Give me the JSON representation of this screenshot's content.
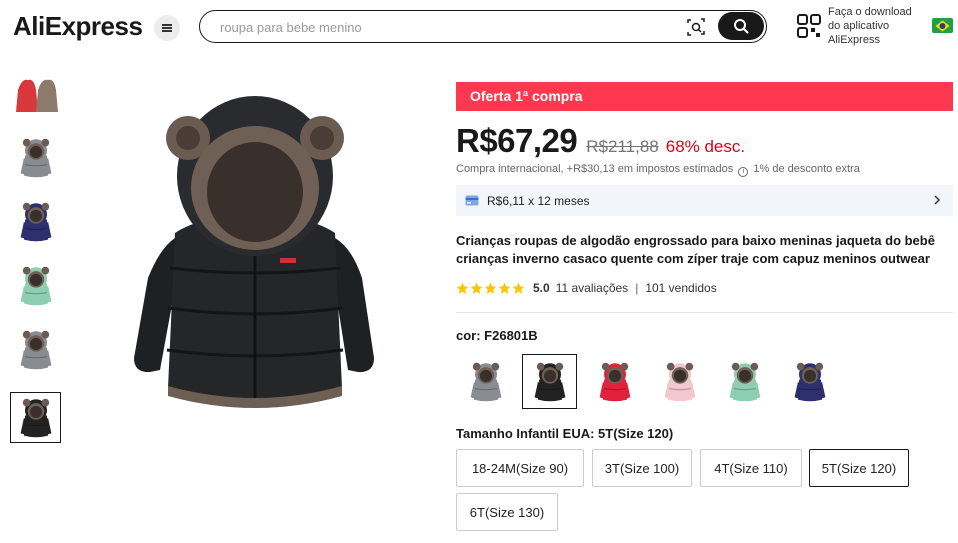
{
  "header": {
    "logo": "AliExpress",
    "search_placeholder": "roupa para bebe menino",
    "app_download_text": "Faça o download do aplicativo AliExpress",
    "icons": [
      "menu-icon",
      "camera-search-icon",
      "search-icon",
      "qr-code-icon",
      "brazil-flag-icon"
    ]
  },
  "thumbnails": [
    {
      "color": "#d8373c",
      "alt_color": "#8c7a6b"
    },
    {
      "color": "#8a8c93"
    },
    {
      "color": "#2d2f6e"
    },
    {
      "color": "#8fcfb1"
    },
    {
      "color": "#8a8c93"
    },
    {
      "color": "#222222",
      "active": true
    }
  ],
  "product": {
    "promo_label": "Oferta 1ª compra",
    "price": "R$67,29",
    "old_price": "R$211,88",
    "discount": "68% desc.",
    "tax_text": "Compra internacional, +R$30,13 em impostos estimados",
    "extra_discount": "1% de desconto extra",
    "installments": "R$6,11 x 12 meses",
    "title": "Crianças roupas de algodão engrossado para baixo meninas jaqueta do bebê crianças inverno casaco quente com zíper traje com capuz meninos outwear",
    "rating_value": "5.0",
    "reviews": "11 avaliações",
    "sold": "101 vendidos",
    "stars": 5,
    "color_label": "cor: F26801B",
    "colors": [
      {
        "name": "gray",
        "hex": "#8a8c93"
      },
      {
        "name": "black",
        "hex": "#222222",
        "selected": true
      },
      {
        "name": "red",
        "hex": "#e0223a"
      },
      {
        "name": "pink",
        "hex": "#f2c7cf"
      },
      {
        "name": "mint",
        "hex": "#8fcfb1"
      },
      {
        "name": "navy",
        "hex": "#2d2f6e"
      }
    ],
    "size_label": "Tamanho Infantil EUA: 5T(Size 120)",
    "sizes": [
      {
        "label": "18-24M(Size 90)"
      },
      {
        "label": "3T(Size 100)"
      },
      {
        "label": "4T(Size 110)"
      },
      {
        "label": "5T(Size 120)",
        "selected": true
      },
      {
        "label": "6T(Size 130)"
      }
    ]
  },
  "colors": {
    "promo_bg": "#fd384f",
    "discount": "#e1001a",
    "star": "#fdc500",
    "install_bg": "#f2f5fa"
  }
}
